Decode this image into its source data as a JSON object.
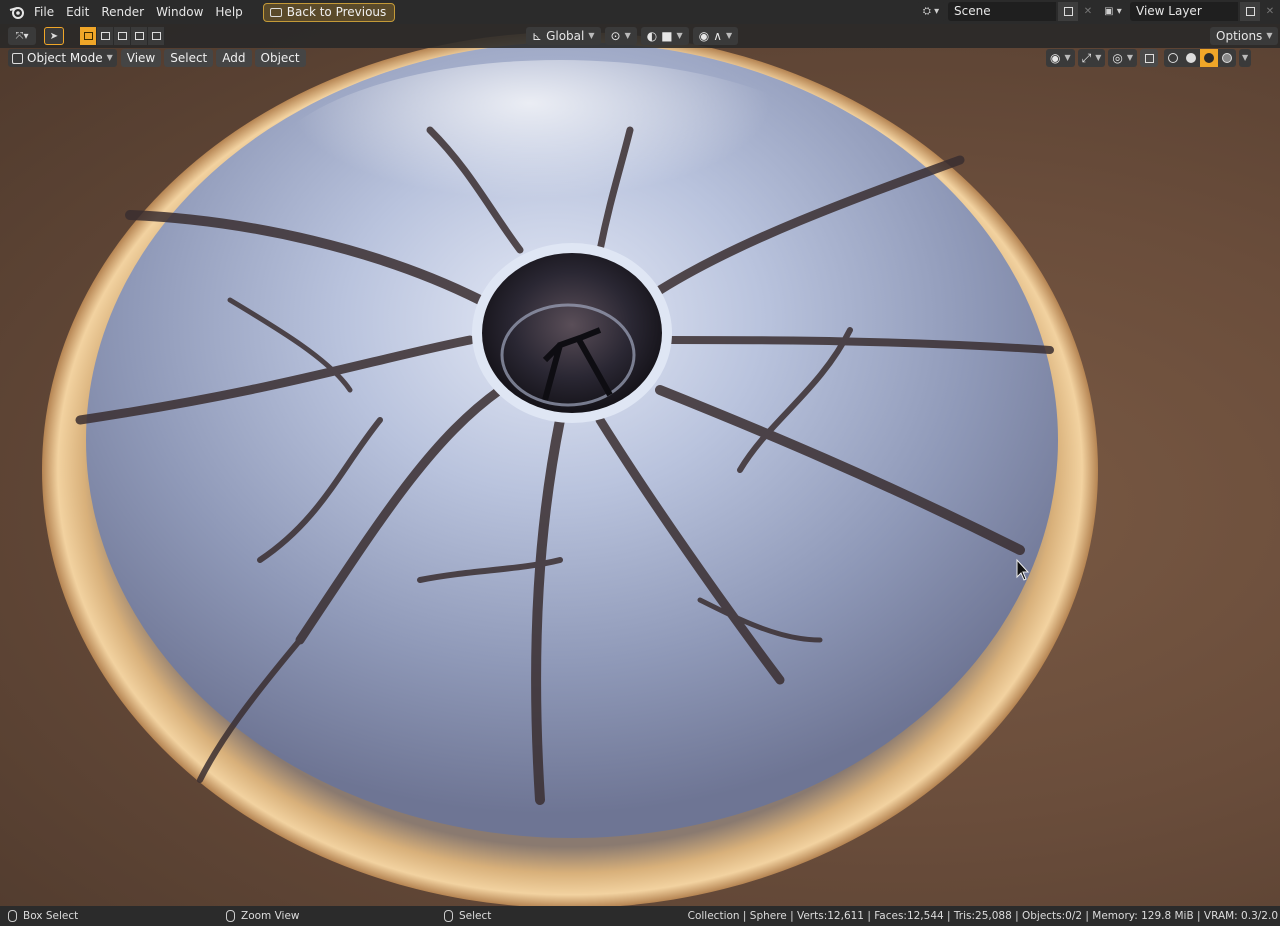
{
  "menu": {
    "items": [
      "File",
      "Edit",
      "Render",
      "Window",
      "Help"
    ],
    "back_button": "Back to Previous"
  },
  "scene": {
    "name": "Scene"
  },
  "view_layer": {
    "name": "View Layer"
  },
  "header": {
    "transform_orientation": "Global",
    "options_label": "Options",
    "mode": "Object Mode",
    "view_menu": [
      "View",
      "Select",
      "Add",
      "Object"
    ]
  },
  "status": {
    "left_action": "Box Select",
    "middle_action": "Zoom View",
    "right_action": "Select",
    "stats": "Collection | Sphere | Verts:12,611 | Faces:12,544 | Tris:25,088 | Objects:0/2 | Memory: 129.8 MiB | VRAM: 0.3/2.0"
  },
  "colors": {
    "accent": "#f0a628",
    "menubar": "#2b2b2b",
    "viewport_bg": "#6a4d3b"
  }
}
